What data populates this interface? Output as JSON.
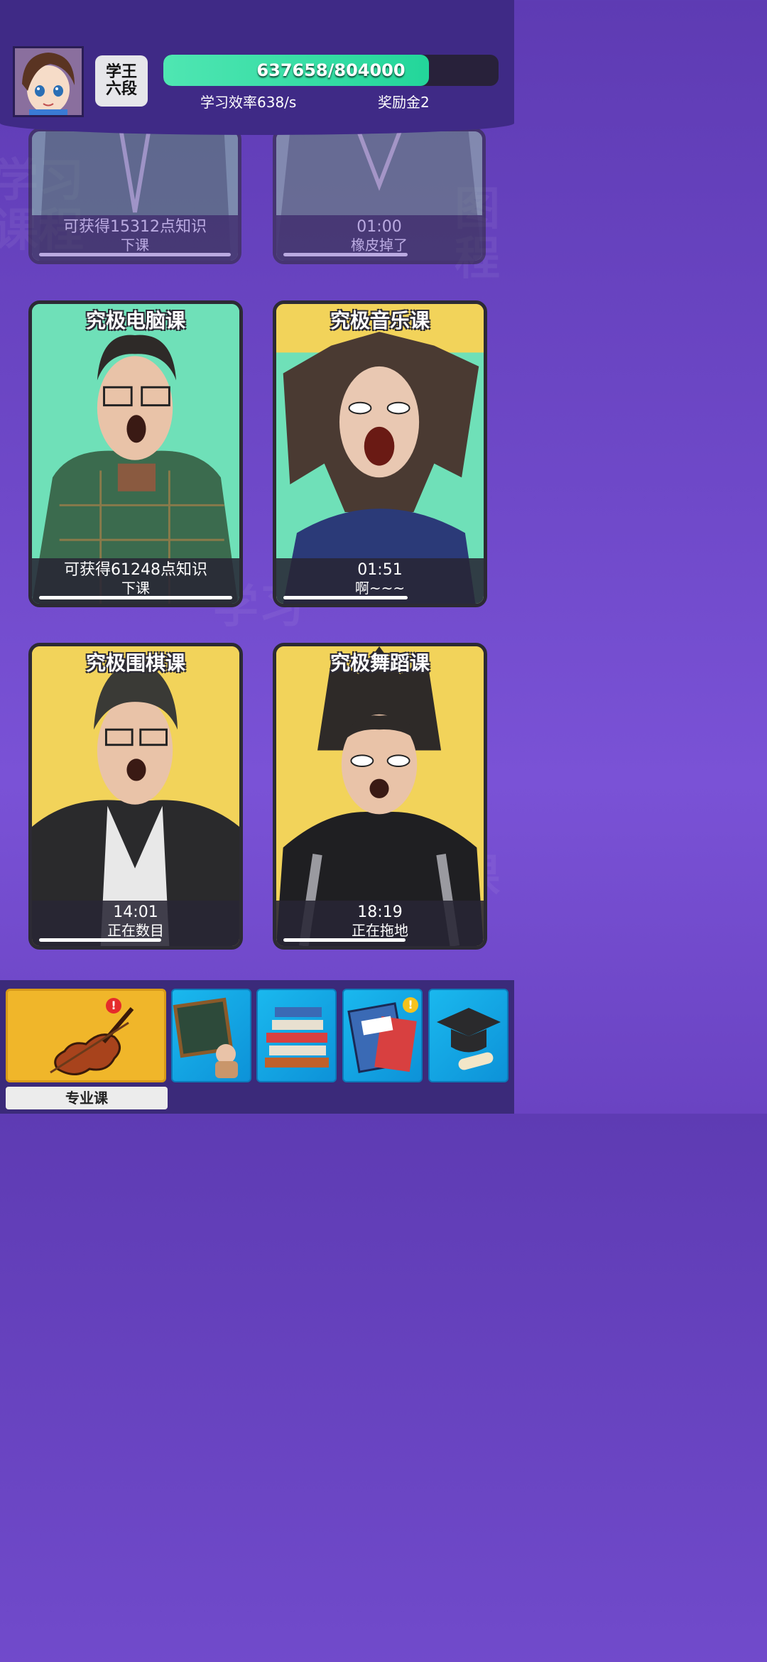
{
  "header": {
    "rank": "学王\n六段",
    "progress_text": "637658/804000",
    "progress_fraction": 0.793,
    "rate": "学习效率638/s",
    "reward": "奖励金2"
  },
  "cards": [
    {
      "title": "",
      "line1": "可获得15312点知识",
      "line2": "下课",
      "bar": 0.93
    },
    {
      "title": "",
      "line1": "01:00",
      "line2": "橡皮掉了",
      "bar": 0.6
    },
    {
      "title": "究极电脑课",
      "line1": "可获得61248点知识",
      "line2": "下课",
      "bar": 0.93
    },
    {
      "title": "究极音乐课",
      "line1": "01:51",
      "line2": "啊~~~",
      "bar": 0.6
    },
    {
      "title": "究极围棋课",
      "line1": "14:01",
      "line2": "正在数目",
      "bar": 0.62
    },
    {
      "title": "究极舞蹈课",
      "line1": "18:19",
      "line2": "正在拖地",
      "bar": 0.62
    }
  ],
  "nav": {
    "active_label": "专业课",
    "icons": [
      "violin-icon",
      "blackboard-icon",
      "book-stack-icon",
      "composition-book-icon",
      "graduation-cap-icon"
    ],
    "colors": {
      "active": "#f0b62a",
      "tab": "#1ab8ee",
      "badge_red": "#e52b2b",
      "badge_yellow": "#f6c21c"
    }
  }
}
